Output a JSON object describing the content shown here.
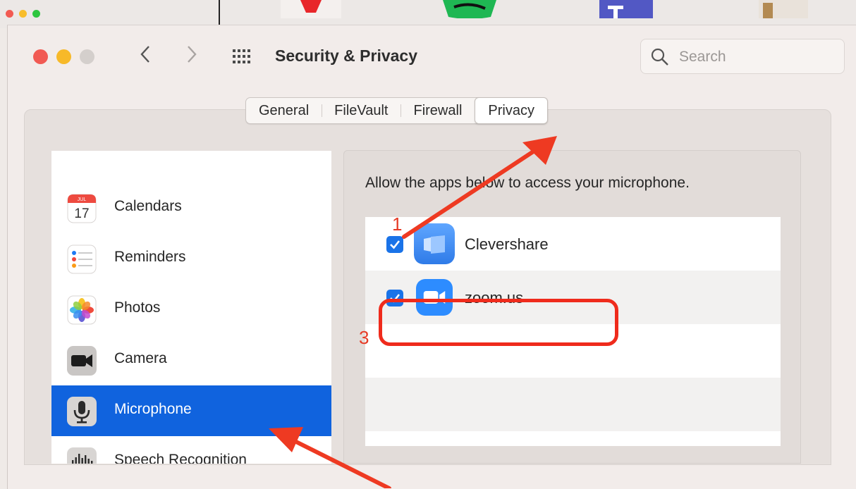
{
  "window": {
    "title": "Security & Privacy",
    "back_icon": "chevron-left-icon",
    "forward_icon": "chevron-right-icon",
    "grid_icon": "show-all-grid-icon"
  },
  "search": {
    "placeholder": "Search",
    "value": ""
  },
  "tabs": [
    {
      "label": "General",
      "active": false
    },
    {
      "label": "FileVault",
      "active": false
    },
    {
      "label": "Firewall",
      "active": false
    },
    {
      "label": "Privacy",
      "active": true
    }
  ],
  "sidebar": {
    "items": [
      {
        "label": "Calendars",
        "icon": "calendar-icon",
        "selected": false,
        "calendar_month": "JUL",
        "calendar_day": "17"
      },
      {
        "label": "Reminders",
        "icon": "reminders-icon",
        "selected": false
      },
      {
        "label": "Photos",
        "icon": "photos-icon",
        "selected": false
      },
      {
        "label": "Camera",
        "icon": "camera-icon",
        "selected": false
      },
      {
        "label": "Microphone",
        "icon": "microphone-icon",
        "selected": true
      },
      {
        "label": "Speech Recognition",
        "icon": "speech-recognition-icon",
        "selected": false
      }
    ]
  },
  "main": {
    "heading": "Allow the apps below to access your microphone.",
    "apps": [
      {
        "name": "Clevershare",
        "checked": true,
        "icon": "clevershare-icon"
      },
      {
        "name": "zoom.us",
        "checked": true,
        "icon": "zoom-icon"
      }
    ]
  },
  "annotations": {
    "step1": "1",
    "step3": "3"
  },
  "colors": {
    "selected_row": "#1063de",
    "checkbox": "#1a73e8",
    "annotation_red": "#e63b26"
  }
}
